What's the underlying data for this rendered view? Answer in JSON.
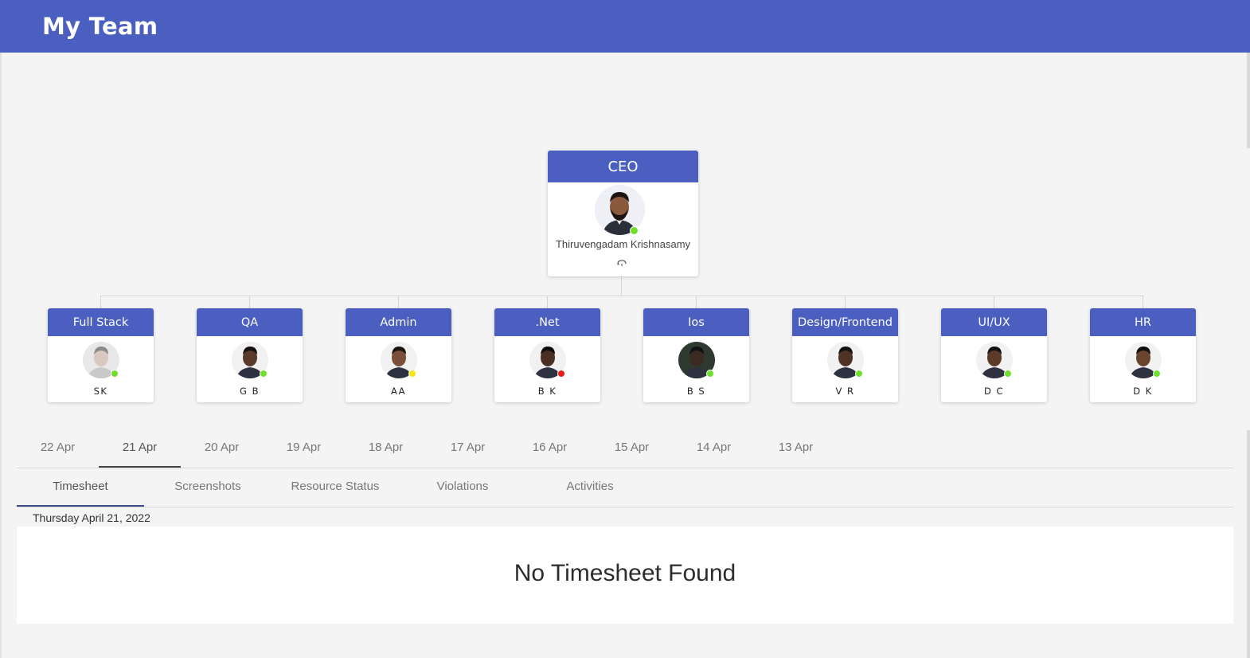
{
  "header": {
    "title": "My Team"
  },
  "colors": {
    "brand": "#4a5fbf",
    "online": "#6ee02b",
    "away": "#f5e616",
    "busy": "#ee1b1b"
  },
  "ceo": {
    "role": "CEO",
    "name": "Thiruvengadam Krishnasamy",
    "status": "online",
    "icon": "collapse-icon"
  },
  "teams": [
    {
      "role": "Full Stack",
      "initials": "SK",
      "status": "online"
    },
    {
      "role": "QA",
      "initials": "G B",
      "status": "online"
    },
    {
      "role": "Admin",
      "initials": "AA",
      "status": "away"
    },
    {
      "role": ".Net",
      "initials": "B K",
      "status": "busy"
    },
    {
      "role": "Ios",
      "initials": "B S",
      "status": "online"
    },
    {
      "role": "Design/Frontend",
      "initials": "V R",
      "status": "online"
    },
    {
      "role": "UI/UX",
      "initials": "D C",
      "status": "online"
    },
    {
      "role": "HR",
      "initials": "D K",
      "status": "online"
    }
  ],
  "date_tabs": [
    "22 Apr",
    "21 Apr",
    "20 Apr",
    "19 Apr",
    "18 Apr",
    "17 Apr",
    "16 Apr",
    "15 Apr",
    "14 Apr",
    "13 Apr"
  ],
  "active_date_tab": "21 Apr",
  "sub_tabs": [
    "Timesheet",
    "Screenshots",
    "Resource Status",
    "Violations",
    "Activities"
  ],
  "active_sub_tab": "Timesheet",
  "selected_date": "Thursday April 21, 2022",
  "empty_message": "No Timesheet Found"
}
